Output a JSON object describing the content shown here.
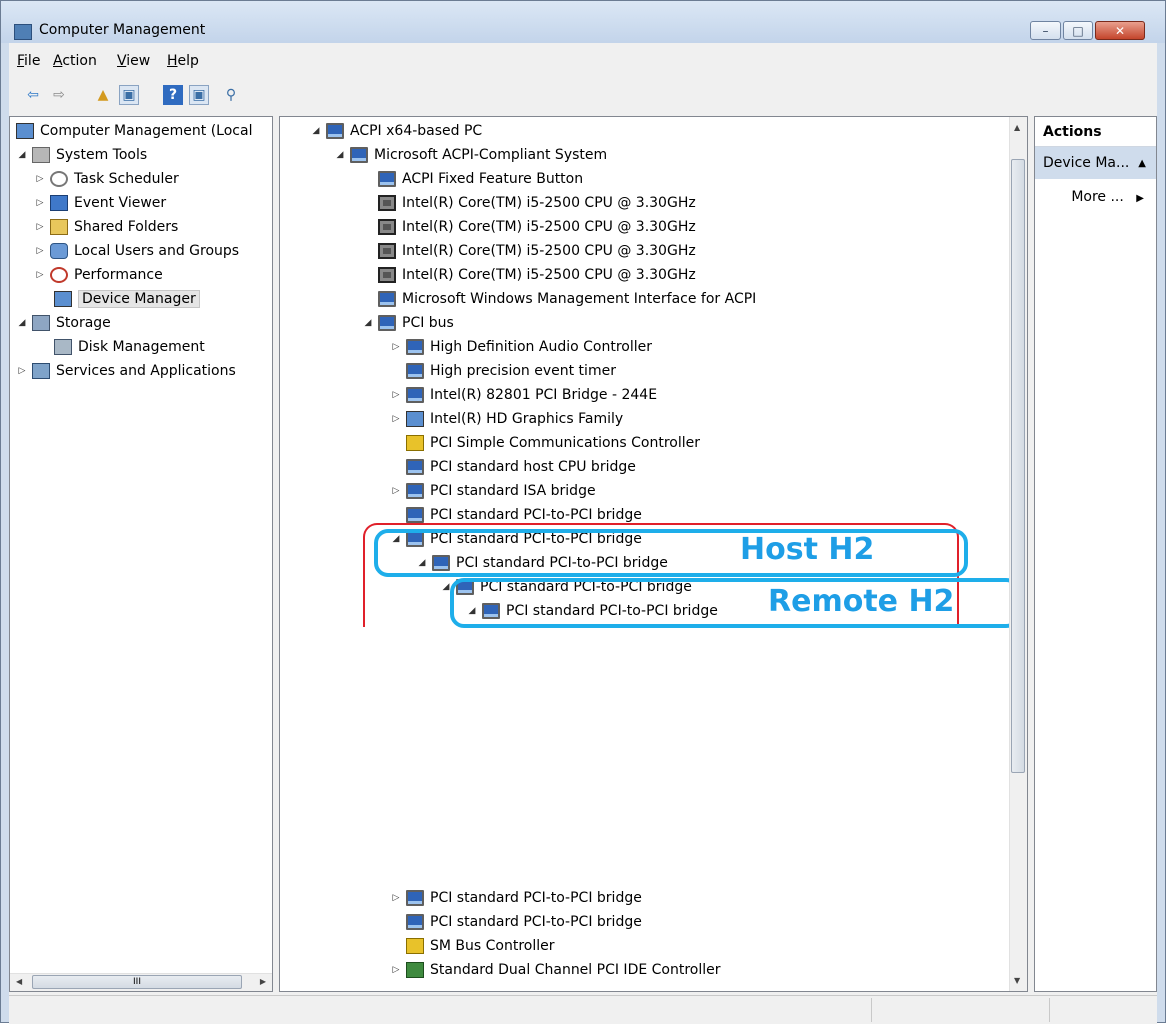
{
  "window": {
    "title": "Computer Management",
    "minimize": "–",
    "maximize": "□",
    "close": "✕"
  },
  "menu": [
    "File",
    "Action",
    "View",
    "Help"
  ],
  "toolbar": [
    {
      "icon": "back-arrow-icon",
      "glyph": "⇦"
    },
    {
      "icon": "forward-arrow-icon",
      "glyph": "⇨"
    },
    {
      "icon": "up-folder-icon",
      "glyph": "▲"
    },
    {
      "icon": "show-hide-console-tree-icon",
      "glyph": "▣"
    },
    {
      "icon": "help-icon",
      "glyph": "?"
    },
    {
      "icon": "show-hide-action-pane-icon",
      "glyph": "▣"
    },
    {
      "icon": "properties-icon",
      "glyph": "⚲"
    }
  ],
  "left_tree": [
    {
      "label": "Computer Management (Local",
      "icon": "computer-management-icon"
    },
    {
      "label": "System Tools",
      "icon": "system-tools-icon"
    },
    {
      "label": "Task Scheduler",
      "icon": "task-scheduler-icon"
    },
    {
      "label": "Event Viewer",
      "icon": "event-viewer-icon"
    },
    {
      "label": "Shared Folders",
      "icon": "shared-folders-icon"
    },
    {
      "label": "Local Users and Groups",
      "icon": "local-users-icon"
    },
    {
      "label": "Performance",
      "icon": "performance-icon"
    },
    {
      "label": "Device Manager",
      "icon": "device-manager-icon",
      "selected": true
    },
    {
      "label": "Storage",
      "icon": "storage-icon"
    },
    {
      "label": "Disk Management",
      "icon": "disk-management-icon"
    },
    {
      "label": "Services and Applications",
      "icon": "services-applications-icon"
    }
  ],
  "devices_top": [
    "ACPI x64-based PC",
    "Microsoft ACPI-Compliant System",
    "ACPI Fixed Feature Button",
    "Intel(R) Core(TM) i5-2500 CPU @ 3.30GHz",
    "Intel(R) Core(TM) i5-2500 CPU @ 3.30GHz",
    "Intel(R) Core(TM) i5-2500 CPU @ 3.30GHz",
    "Intel(R) Core(TM) i5-2500 CPU @ 3.30GHz",
    "Microsoft Windows Management Interface for ACPI",
    "PCI bus",
    "High Definition Audio Controller",
    "High precision event timer",
    "Intel(R) 82801 PCI Bridge - 244E",
    "Intel(R) HD Graphics Family",
    "PCI Simple Communications Controller",
    "PCI standard host CPU bridge",
    "PCI standard ISA bridge",
    "PCI standard PCI-to-PCI bridge",
    "PCI standard PCI-to-PCI bridge",
    "PCI standard PCI-to-PCI bridge",
    "PCI standard PCI-to-PCI bridge",
    "PCI standard PCI-to-PCI bridge"
  ],
  "devices_bottom": [
    "PCI standard PCI-to-PCI bridge",
    "PCI standard PCI-to-PCI bridge",
    "SM Bus Controller",
    "Standard Dual Channel PCI IDE Controller"
  ],
  "annotations": {
    "host": "Host H2",
    "remote": "Remote H2"
  },
  "actions": {
    "title": "Actions",
    "section": "Device Ma...",
    "more": "More ..."
  },
  "scroll": {
    "hthumb_label": "III"
  }
}
